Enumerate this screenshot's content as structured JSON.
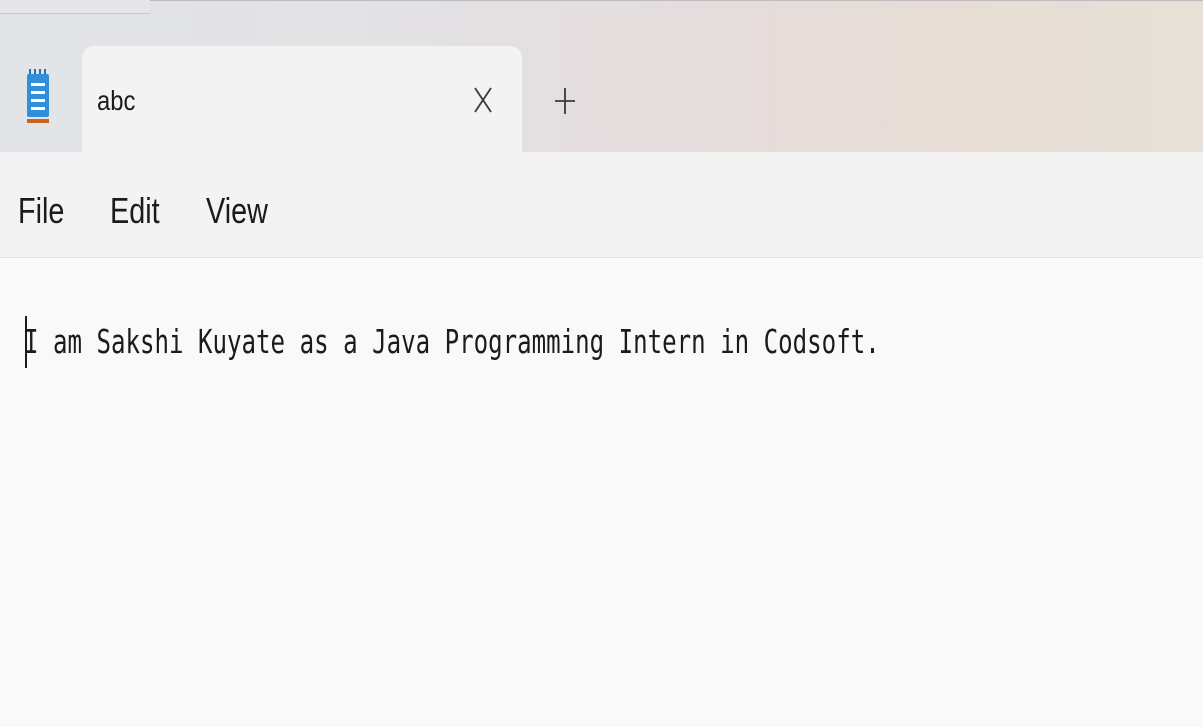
{
  "tabs": [
    {
      "title": "abc",
      "active": true
    }
  ],
  "tab_actions": {
    "close_icon": "close-icon",
    "new_tab_icon": "plus-icon"
  },
  "app_icon": "notepad-icon",
  "menu": {
    "items": [
      {
        "label": "File"
      },
      {
        "label": "Edit"
      },
      {
        "label": "View"
      }
    ]
  },
  "editor": {
    "text": "I am Sakshi Kuyate as a Java Programming Intern in Codsoft."
  },
  "colors": {
    "icon_blue": "#2f8fd8",
    "icon_orange": "#c8651b",
    "text": "#1b1b1b",
    "menubar_bg": "#f3f3f3",
    "editor_bg": "#f9f9f9"
  }
}
